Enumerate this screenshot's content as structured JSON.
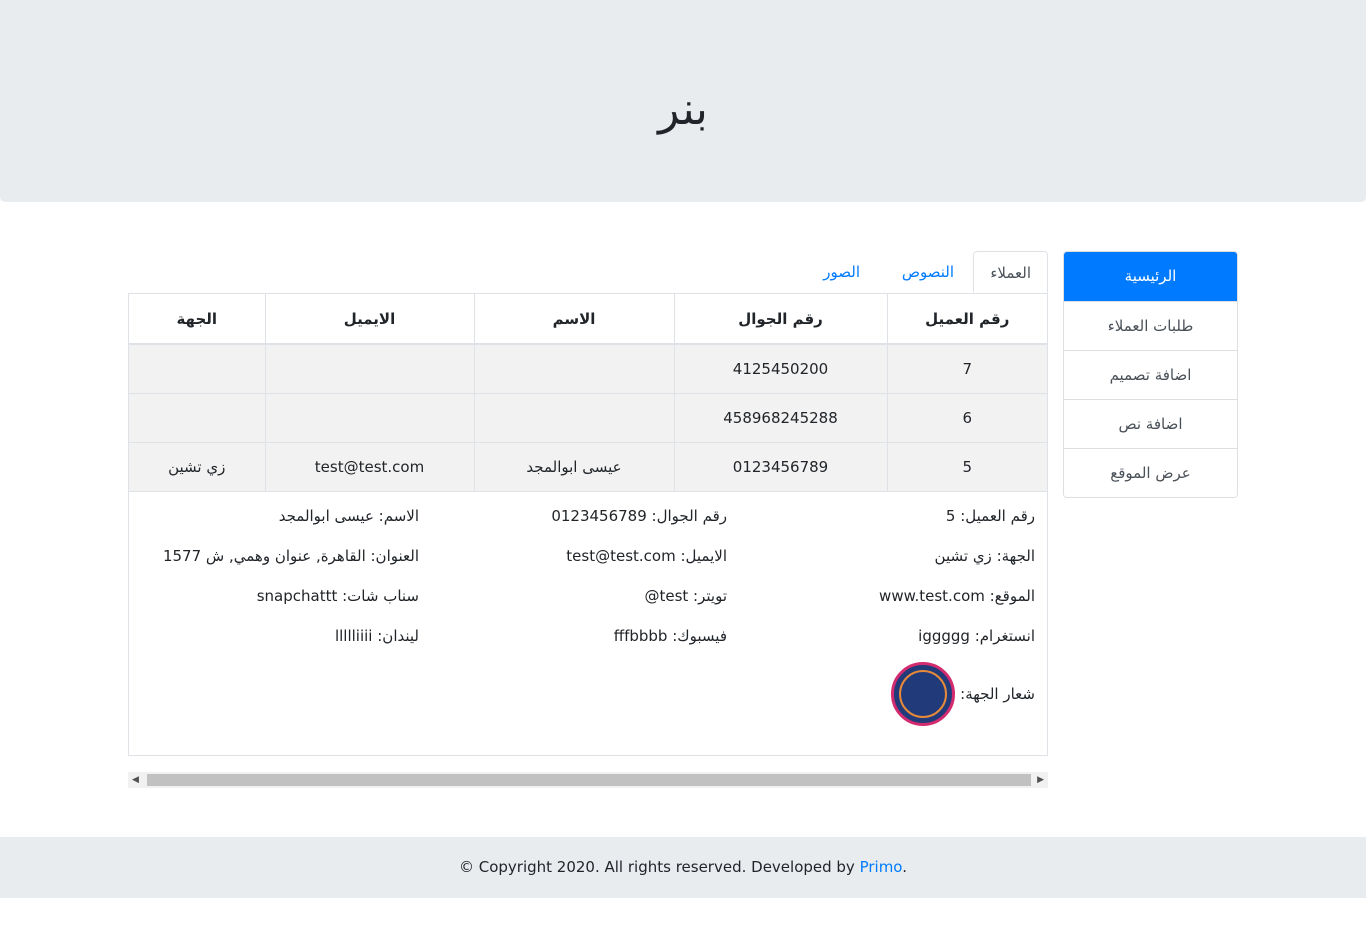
{
  "banner": {
    "title": "بنر"
  },
  "sidebar": {
    "items": [
      {
        "label": "الرئيسية",
        "active": true
      },
      {
        "label": "طلبات العملاء"
      },
      {
        "label": "اضافة تصميم"
      },
      {
        "label": "اضافة نص"
      },
      {
        "label": "عرض الموقع"
      }
    ]
  },
  "tabs": [
    {
      "label": "العملاء",
      "active": true
    },
    {
      "label": "النصوص"
    },
    {
      "label": "الصور"
    }
  ],
  "table": {
    "headers": [
      "رقم العميل",
      "رقم الجوال",
      "الاسم",
      "الايميل",
      "الجهة"
    ],
    "rows": [
      [
        "7",
        "4125450200",
        "",
        "",
        ""
      ],
      [
        "6",
        "458968245288",
        "",
        "",
        ""
      ],
      [
        "5",
        "0123456789",
        "عيسى ابوالمجد",
        "test@test.com",
        "زي تشين"
      ]
    ]
  },
  "details": {
    "customer_no": "رقم العميل: 5",
    "mobile": "رقم الجوال: 0123456789",
    "name": "الاسم: عيسى ابوالمجد",
    "entity": "الجهة: زي تشين",
    "email": "الايميل: test@test.com",
    "address": "العنوان: القاهرة, عنوان وهمي, ش 1577",
    "website": "الموقع: www.test.com",
    "twitter": "تويتر: test@",
    "snapchat": "سناب شات: snapchattt",
    "instagram": "انستغرام: iggggg",
    "facebook": "فيسبوك: fffbbbb",
    "linkedin": "ليندان: llllliiii",
    "logo_label": "شعار الجهة:"
  },
  "footer": {
    "text_before": "© Copyright 2020. All rights reserved. Developed by ",
    "link": "Primo",
    "text_after": "."
  },
  "colors": {
    "accent": "#007bff",
    "banner_bg": "#e9ecef"
  }
}
